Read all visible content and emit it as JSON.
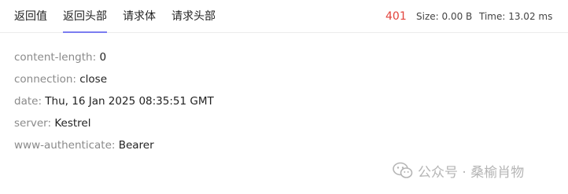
{
  "tabs": [
    {
      "label": "返回值"
    },
    {
      "label": "返回头部",
      "active": true
    },
    {
      "label": "请求体"
    },
    {
      "label": "请求头部"
    }
  ],
  "status": {
    "code": "401",
    "size": "Size: 0.00 B",
    "time": "Time: 13.02 ms",
    "code_color": "#e2433c"
  },
  "headers": [
    {
      "key": "content-length",
      "value": "0"
    },
    {
      "key": "connection",
      "value": "close"
    },
    {
      "key": "date",
      "value": "Thu, 16 Jan 2025 08:35:51 GMT"
    },
    {
      "key": "server",
      "value": "Kestrel"
    },
    {
      "key": "www-authenticate",
      "value": "Bearer"
    }
  ],
  "watermark": {
    "text": "公众号 · 桑榆肖物",
    "icon": "wechat-icon"
  },
  "colors": {
    "accent": "#7b7df0",
    "error": "#e2433c"
  }
}
